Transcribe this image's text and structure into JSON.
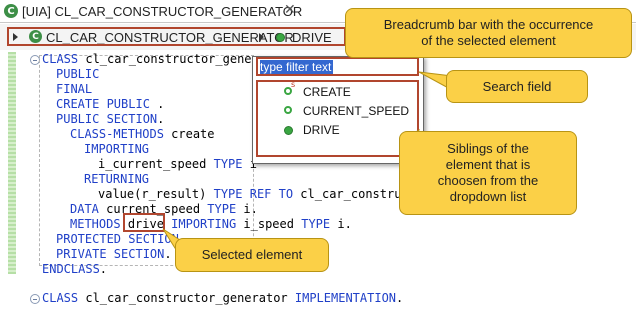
{
  "tab": {
    "icon_letter": "C",
    "title": "[UIA] CL_CAR_CONSTRUCTOR_GENERATOR",
    "close": "✕"
  },
  "breadcrumb": {
    "icon_letter": "C",
    "class_name": "CL_CAR_CONSTRUCTOR_GENERATOR",
    "member": "DRIVE"
  },
  "code": {
    "lines": [
      {
        "kw": "CLASS",
        "rest": " cl_car_constructor_gener"
      },
      {
        "kw": "PUBLIC",
        "rest": ""
      },
      {
        "kw": "FINAL",
        "rest": ""
      },
      {
        "kw": "CREATE PUBLIC",
        "rest": " ."
      },
      {
        "kw": "PUBLIC SECTION",
        "rest": "."
      },
      {
        "kw": "CLASS-METHODS",
        "rest": " create"
      },
      {
        "kw": "IMPORTING",
        "rest": ""
      },
      {
        "pre": "i_current_speed ",
        "kw": "TYPE",
        "rest": " i"
      },
      {
        "kw": "RETURNING",
        "rest": ""
      },
      {
        "pre": "value(r_result) ",
        "kw": "TYPE REF TO",
        "rest": " cl_car_construc"
      },
      {
        "kw": "DATA",
        "rest": " current_speed ",
        "kw2": "TYPE",
        "rest2": " i."
      },
      {
        "kw": "METHODS",
        "rest": " ",
        "sel": "drive",
        "kw2": " IMPORTING",
        "rest2": " i_speed ",
        "kw3": "TYPE",
        "rest3": " i."
      },
      {
        "kw": "PROTECTED SECTION",
        "rest": ""
      },
      {
        "kw": "PRIVATE SECTION",
        "rest": "."
      },
      {
        "kw": "ENDCLASS",
        "rest": "."
      },
      {
        "kw": "CLASS",
        "rest": " cl_car_constructor_generator ",
        "kw2": "IMPLEMENTATION",
        "rest2": "."
      }
    ]
  },
  "popup": {
    "search_value": "type filter text",
    "items": [
      {
        "label": "CREATE",
        "icon": "static-method-icon",
        "sup": "s"
      },
      {
        "label": "CURRENT_SPEED",
        "icon": "attribute-icon"
      },
      {
        "label": "DRIVE",
        "icon": "method-icon"
      }
    ]
  },
  "callouts": {
    "breadcrumb": "Breadcrumb bar with the occurrence of the selected element",
    "search": "Search field",
    "siblings": "Siblings of the element that is choosen from the dropdown list",
    "selected": "Selected element"
  },
  "colors": {
    "keyword": "#2040c8",
    "highlight_box": "#b1462e",
    "callout_fill": "#fbd047",
    "selection": "#3468d0"
  }
}
